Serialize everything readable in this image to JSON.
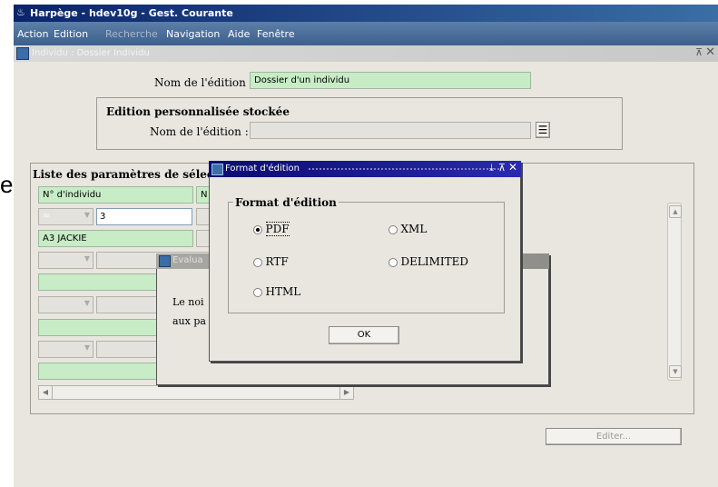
{
  "window": {
    "title": "Harpège - hdev10g - Gest. Courante"
  },
  "menu": {
    "items": [
      "Action",
      "Edition",
      "Recherche",
      "Navigation",
      "Aide",
      "Fenêtre"
    ]
  },
  "inner_window": {
    "title": "Individu : Dossier Individu"
  },
  "form": {
    "nom_edition_label": "Nom de l'édition :",
    "nom_edition_value": "Dossier d'un individu",
    "edition_perso_title": "Edition personnalisée stockée",
    "nom_edition_label2": "Nom de l'édition :",
    "liste_params_title": "Liste des paramètres de sélect",
    "param_name": "N° d'individu",
    "param_short": "N",
    "operator": "=",
    "param_value": "3",
    "param_label": "A3 JACKIE",
    "editer_button": "Editer..."
  },
  "evaluation_dialog": {
    "title": "Evalua",
    "text_line1": "Le noi",
    "text_line2": "aux pa"
  },
  "format_dialog": {
    "title": "Format d'édition",
    "group_title": "Format d'édition",
    "options": [
      {
        "label": "PDF",
        "selected": true
      },
      {
        "label": "XML",
        "selected": false
      },
      {
        "label": "RTF",
        "selected": false
      },
      {
        "label": "DELIMITED",
        "selected": false
      },
      {
        "label": "HTML",
        "selected": false
      }
    ],
    "ok_button": "OK"
  },
  "background_text": {
    "edge_letter": "e"
  }
}
